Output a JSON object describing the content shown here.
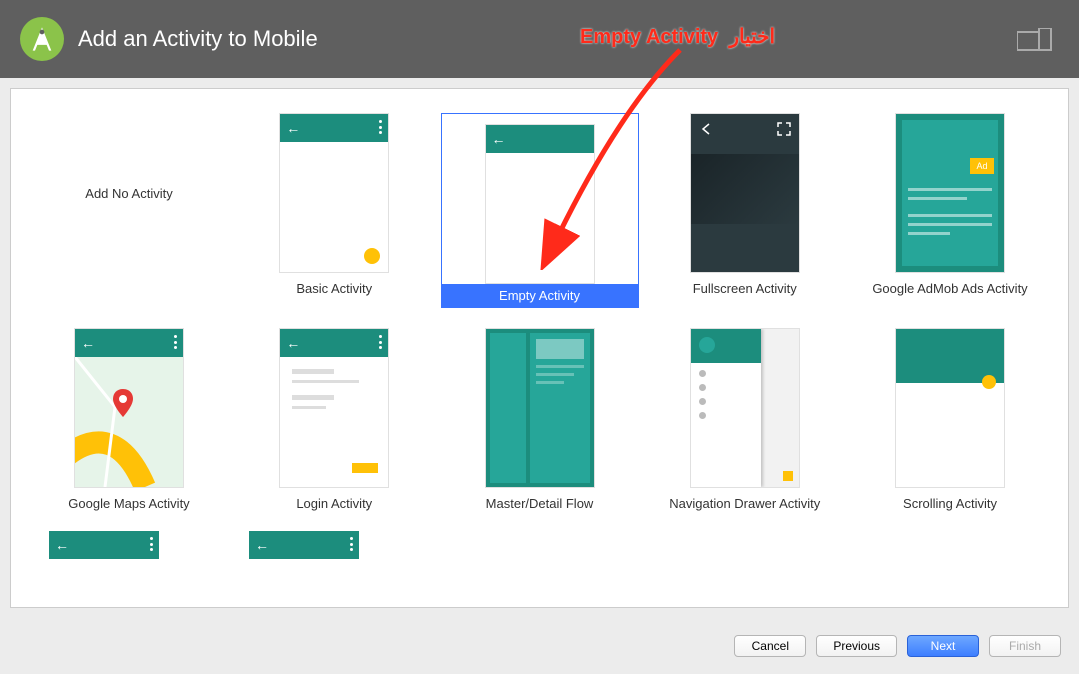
{
  "header": {
    "title": "Add an Activity to Mobile"
  },
  "annotation": {
    "text_en": "Empty Activity",
    "text_ar": "اختيار"
  },
  "templates": {
    "items": [
      {
        "label": "Add No Activity"
      },
      {
        "label": "Basic Activity"
      },
      {
        "label": "Empty Activity"
      },
      {
        "label": "Fullscreen Activity"
      },
      {
        "label": "Google AdMob Ads Activity"
      },
      {
        "label": "Google Maps Activity"
      },
      {
        "label": "Login Activity"
      },
      {
        "label": "Master/Detail Flow"
      },
      {
        "label": "Navigation Drawer Activity"
      },
      {
        "label": "Scrolling Activity"
      }
    ],
    "ad_badge": "Ad",
    "selected_index": 2
  },
  "footer": {
    "cancel": "Cancel",
    "previous": "Previous",
    "next": "Next",
    "finish": "Finish"
  }
}
